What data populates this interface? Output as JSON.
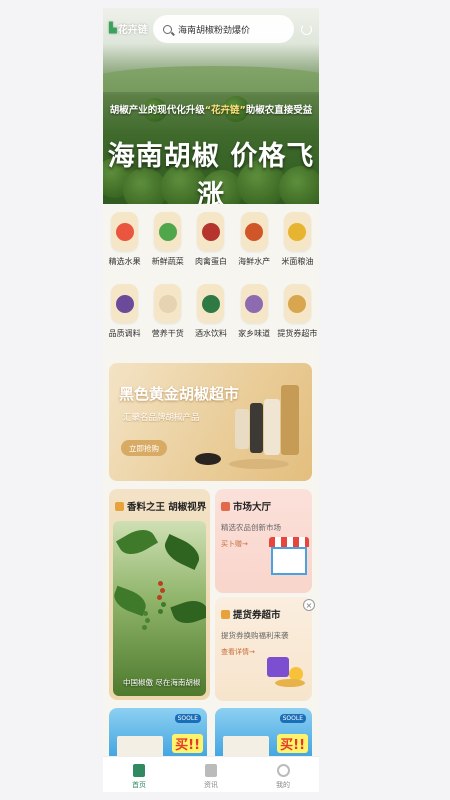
{
  "header": {
    "logo_text": "花卉链",
    "search_value": "海南胡椒粉劲爆价",
    "subtitle_prefix": "胡椒产业的现代化升级",
    "subtitle_brand": "“花卉链”",
    "subtitle_suffix": "助椒农直接受益",
    "headline": "海南胡椒 价格飞涨"
  },
  "categories": [
    {
      "label": "精选水果",
      "icon": "fruit-icon",
      "color": "#e9553f"
    },
    {
      "label": "新鲜蔬菜",
      "icon": "vegetable-icon",
      "color": "#4fa64b"
    },
    {
      "label": "肉禽蛋白",
      "icon": "meat-icon",
      "color": "#b5352e"
    },
    {
      "label": "海鲜水产",
      "icon": "seafood-icon",
      "color": "#d0562a"
    },
    {
      "label": "米面粮油",
      "icon": "grain-oil-icon",
      "color": "#e6b431"
    },
    {
      "label": "品质调料",
      "icon": "seasoning-icon",
      "color": "#6a4a9a"
    },
    {
      "label": "营养干货",
      "icon": "dried-goods-icon",
      "color": "#e5d3b1"
    },
    {
      "label": "酒水饮料",
      "icon": "drinks-icon",
      "color": "#2f7a44"
    },
    {
      "label": "家乡味道",
      "icon": "hometown-food-icon",
      "color": "#8e6bb0"
    },
    {
      "label": "提货券超市",
      "icon": "voucher-icon",
      "color": "#d8a64e"
    }
  ],
  "banner": {
    "title": "黑色黄金胡椒超市",
    "subtitle": "汇聚名品牌胡椒产品",
    "button": "立即抢购"
  },
  "cards": {
    "pepper": {
      "title": "香料之王 胡椒视界",
      "caption": "中国椒傲 尽在海南胡椒"
    },
    "market": {
      "title": "市场大厅",
      "desc": "精选农品创新市场",
      "link": "买卜赠→"
    },
    "voucher": {
      "title": "提货券超市",
      "desc": "提货券换购福利来袭",
      "link": "查看详情→",
      "close": "×"
    },
    "promo1": {
      "badge": "SOOLE",
      "buy": "买!!"
    },
    "promo2": {
      "badge": "SOOLE",
      "buy": "买!!"
    }
  },
  "tabbar": [
    {
      "label": "首页",
      "active": true
    },
    {
      "label": "资讯",
      "active": false
    },
    {
      "label": "我的",
      "active": false
    }
  ],
  "colors": {
    "accent": "#2f8a5f",
    "banner": "#e9cc97"
  }
}
